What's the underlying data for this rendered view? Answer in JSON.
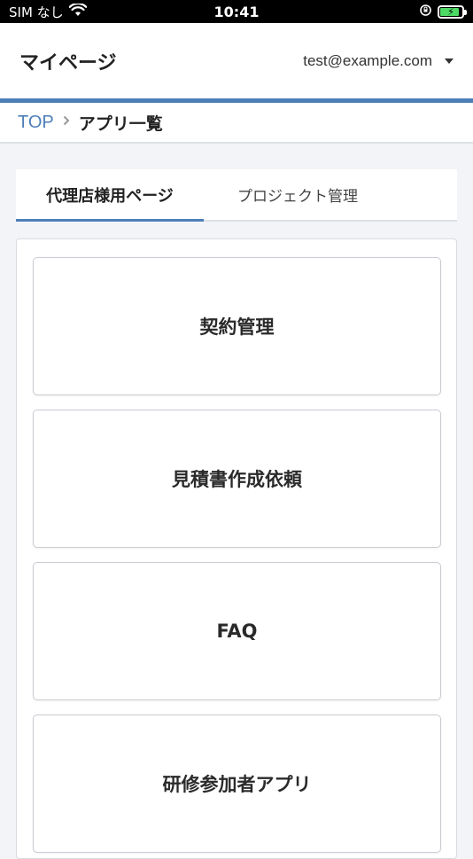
{
  "status_bar": {
    "carrier": "SIM なし",
    "time": "10:41",
    "battery_level": 0.8
  },
  "header": {
    "title": "マイページ",
    "user_email": "test@example.com"
  },
  "breadcrumb": {
    "items": [
      "TOP",
      "アプリ一覧"
    ]
  },
  "tabs": [
    {
      "label": "代理店様用ページ",
      "active": true
    },
    {
      "label": "プロジェクト管理",
      "active": false
    }
  ],
  "apps": [
    {
      "label": "契約管理"
    },
    {
      "label": "見積書作成依頼"
    },
    {
      "label": "FAQ"
    },
    {
      "label": "研修参加者アプリ"
    }
  ],
  "colors": {
    "accent": "#4d7fb8",
    "battery": "#4cd964"
  }
}
